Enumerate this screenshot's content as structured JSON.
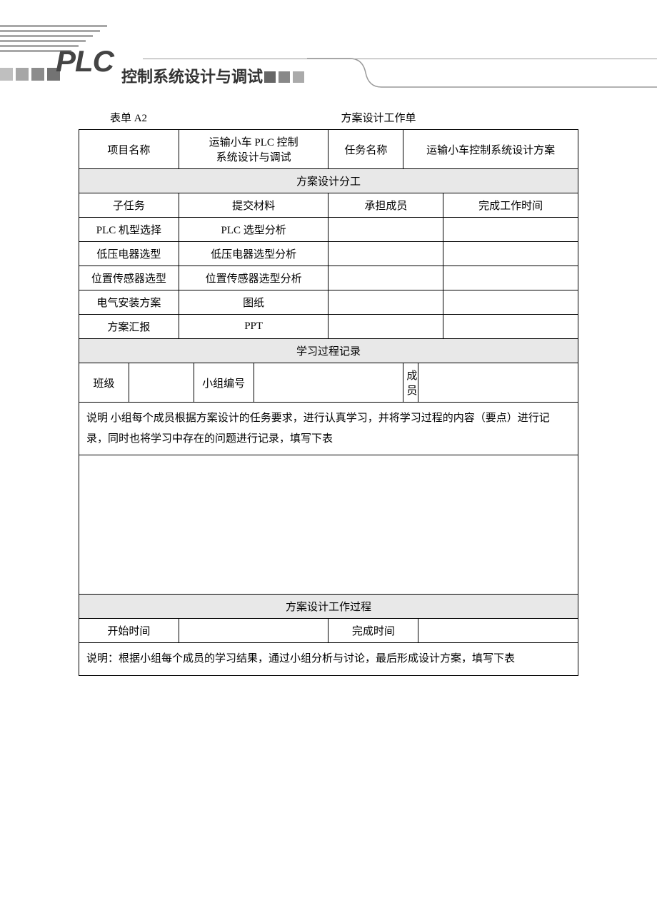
{
  "header": {
    "plc": "PLC",
    "subtitle": "控制系统设计与调试"
  },
  "form_label": "表单 A2",
  "form_title": "方案设计工作单",
  "row1": {
    "project_name_label": "项目名称",
    "project_name_value_l1": "运输小车 PLC 控制",
    "project_name_value_l2": "系统设计与调试",
    "task_name_label": "任务名称",
    "task_name_value": "运输小车控制系统设计方案"
  },
  "section_division": "方案设计分工",
  "div_headers": {
    "subtask": "子任务",
    "material": "提交材料",
    "member": "承担成员",
    "time": "完成工作时间"
  },
  "tasks": [
    {
      "subtask": "PLC 机型选择",
      "material": "PLC 选型分析"
    },
    {
      "subtask": "低压电器选型",
      "material": "低压电器选型分析"
    },
    {
      "subtask": "位置传感器选型",
      "material": "位置传感器选型分析"
    },
    {
      "subtask": "电气安装方案",
      "material": "图纸"
    },
    {
      "subtask": "方案汇报",
      "material": "PPT"
    }
  ],
  "section_record": "学习过程记录",
  "record_row": {
    "class_label": "班级",
    "group_label": "小组编号",
    "member_label": "成员"
  },
  "record_note": "说明 小组每个成员根据方案设计的任务要求，进行认真学习，并将学习过程的内容（要点）进行记录，同时也将学习中存在的问题进行记录，填写下表",
  "section_process": "方案设计工作过程",
  "process_row": {
    "start_label": "开始时间",
    "end_label": "完成时间"
  },
  "process_note": "说明：根据小组每个成员的学习结果，通过小组分析与讨论，最后形成设计方案，填写下表"
}
